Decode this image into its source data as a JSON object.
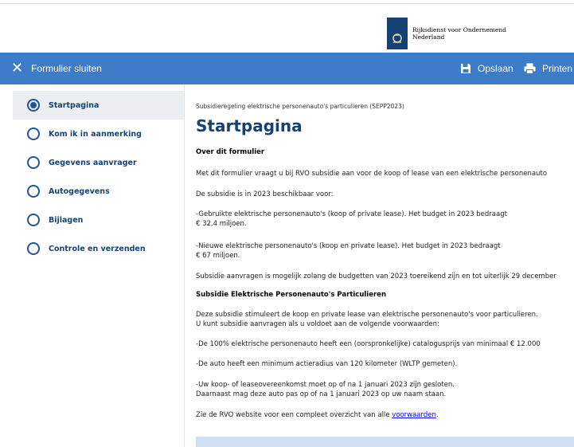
{
  "header": {
    "org_line1": "Rijksdienst voor Ondernemend",
    "org_line2": "Nederland"
  },
  "toolbar": {
    "close_label": "Formulier sluiten",
    "save_label": "Opslaan",
    "print_label": "Printen"
  },
  "sidebar": {
    "steps": [
      {
        "label": "Startpagina"
      },
      {
        "label": "Kom ik in aanmerking"
      },
      {
        "label": "Gegevens aanvrager"
      },
      {
        "label": "Autogegevens"
      },
      {
        "label": "Bijlagen"
      },
      {
        "label": "Controle en verzenden"
      }
    ]
  },
  "main": {
    "breadcrumb": "Subsidieregeling elektrische personenauto's particulieren (SEPP2023)",
    "title": "Startpagina",
    "section1_heading": "Over dit formulier",
    "intro": "Met dit formulier vraagt u bij RVO subsidie aan voor de koop of lease van een elektrische personenauto",
    "availability": "De subsidie is in 2023 beschikbaar voor:",
    "used_line1": "-Gebruikte elektrische personenauto's (koop of private lease). Het budget in 2023 bedraagt",
    "used_line2": "€ 32,4 miljoen.",
    "new_line1": "-Nieuwe elektrische personenauto's (koop en private lease). Het budget in 2023 bedraagt",
    "new_line2": "€ 67 miljoen.",
    "deadline": "Subsidie aanvragen is mogelijk zolang de budgetten van 2023 toereikend zijn en tot uiterlijk 29 december",
    "section2_heading": "Subsidie Elektrische Personenauto's Particulieren",
    "stimulates_line1": "Deze subsidie stimuleert de koop en private lease van elektrische personenauto's voor particulieren.",
    "stimulates_line2": "U kunt subsidie aanvragen als u voldoet aan de volgende voorwaarden:",
    "cond1": "-De 100% elektrische personenauto heeft een (oorspronkelijke) catalogusprijs van minimaal € 12.000",
    "cond2": "-De auto heeft een minimum actieradius van 120 kilometer (WLTP gemeten).",
    "cond3_line1": "-Uw koop- of leaseovereenkomst moet op of na 1 januari 2023 zijn gesloten.",
    "cond3_line2": "Daarnaast mag deze auto pas op of na 1 januari 2023 op uw naam staan.",
    "overview_prefix": "Zie de RVO website voor een compleet overzicht van alle ",
    "overview_link": "voorwaarden",
    "overview_suffix": "."
  },
  "colors": {
    "toolbar_blue": "#3d7cc9",
    "brand_navy": "#154273",
    "active_step_bg": "#eceef1",
    "info_box": "#cfe0f2"
  },
  "icons": [
    "close-icon",
    "save-icon",
    "print-icon",
    "rijksoverheid-logo"
  ]
}
